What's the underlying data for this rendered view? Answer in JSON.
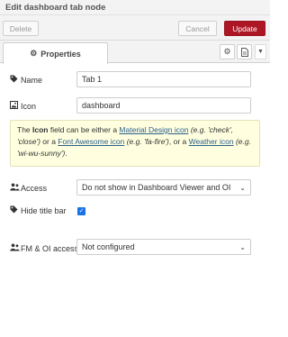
{
  "dialog": {
    "title": "Edit dashboard tab node"
  },
  "toolbar": {
    "delete_label": "Delete",
    "cancel_label": "Cancel",
    "update_label": "Update"
  },
  "tabs": {
    "properties_label": "Properties"
  },
  "form": {
    "name": {
      "label": "Name",
      "value": "Tab 1"
    },
    "icon": {
      "label": "Icon",
      "value": "dashboard"
    },
    "help": {
      "part1": "The ",
      "icon_word": "Icon",
      "part2": " field can be either a ",
      "link1": "Material Design icon",
      "ex1": "(e.g. 'check', 'close')",
      "part3": " or a ",
      "link2": "Font Awesome icon",
      "ex2": "(e.g. 'fa-fire')",
      "part4": ", or a ",
      "link3": "Weather icon",
      "ex3": "(e.g. 'wi-wu-sunny')",
      "part5": "."
    },
    "access": {
      "label": "Access",
      "value": "Do not show in Dashboard Viewer and OI"
    },
    "hide_title": {
      "label": "Hide title bar",
      "checked": true
    },
    "fm_access": {
      "label": "FM & OI access",
      "value": "Not configured"
    }
  },
  "colors": {
    "accent": "#ad1625",
    "checkbox": "#1a73e8",
    "help_bg": "#ffffe0"
  },
  "icons": [
    "gear-icon",
    "document-icon",
    "caret-down-icon",
    "tag-icon",
    "image-icon",
    "users-icon",
    "chevron-down-icon",
    "check-icon"
  ]
}
